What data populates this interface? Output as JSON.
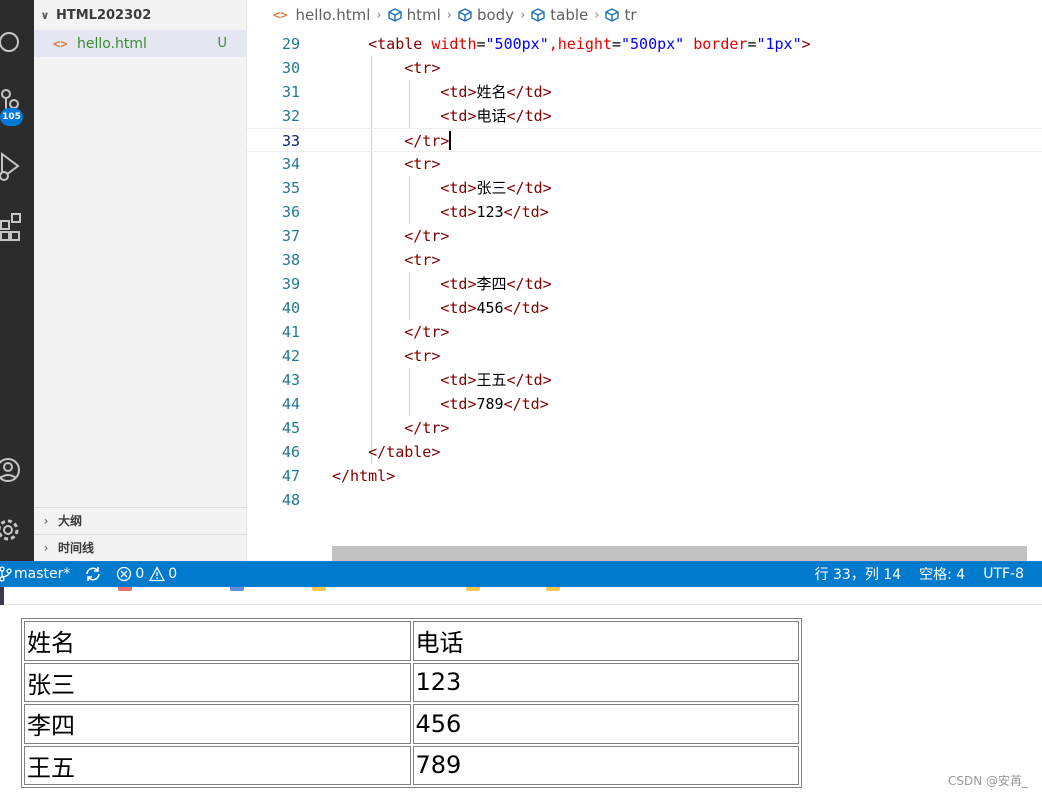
{
  "sidebar": {
    "folder_name": "HTML202302",
    "file_name": "hello.html",
    "file_status": "U",
    "outline_label": "大纲",
    "timeline_label": "时间线",
    "scm_badge": "105"
  },
  "breadcrumb": [
    "hello.html",
    "html",
    "body",
    "table",
    "tr"
  ],
  "editor": {
    "lines": [
      {
        "num": "29",
        "segments": [
          {
            "t": "    ",
            "c": "txt"
          },
          {
            "t": "<table",
            "c": "tag"
          },
          {
            "t": " width",
            "c": "attr"
          },
          {
            "t": "=",
            "c": "txt"
          },
          {
            "t": "\"500px\"",
            "c": "val"
          },
          {
            "t": ",height",
            "c": "attr"
          },
          {
            "t": "=",
            "c": "txt"
          },
          {
            "t": "\"500px\"",
            "c": "val"
          },
          {
            "t": " border",
            "c": "attr"
          },
          {
            "t": "=",
            "c": "txt"
          },
          {
            "t": "\"1px\"",
            "c": "val"
          },
          {
            "t": ">",
            "c": "tag"
          }
        ]
      },
      {
        "num": "30",
        "segments": [
          {
            "t": "        ",
            "c": "txt"
          },
          {
            "t": "<tr>",
            "c": "tag"
          }
        ]
      },
      {
        "num": "31",
        "segments": [
          {
            "t": "            ",
            "c": "txt"
          },
          {
            "t": "<td>",
            "c": "tag"
          },
          {
            "t": "姓名",
            "c": "txt"
          },
          {
            "t": "</td>",
            "c": "tag"
          }
        ]
      },
      {
        "num": "32",
        "segments": [
          {
            "t": "            ",
            "c": "txt"
          },
          {
            "t": "<td>",
            "c": "tag"
          },
          {
            "t": "电话",
            "c": "txt"
          },
          {
            "t": "</td>",
            "c": "tag"
          }
        ]
      },
      {
        "num": "33",
        "segments": [
          {
            "t": "        ",
            "c": "txt"
          },
          {
            "t": "</tr>",
            "c": "tag"
          }
        ],
        "current": true
      },
      {
        "num": "34",
        "segments": [
          {
            "t": "        ",
            "c": "txt"
          },
          {
            "t": "<tr>",
            "c": "tag"
          }
        ]
      },
      {
        "num": "35",
        "segments": [
          {
            "t": "            ",
            "c": "txt"
          },
          {
            "t": "<td>",
            "c": "tag"
          },
          {
            "t": "张三",
            "c": "txt"
          },
          {
            "t": "</td>",
            "c": "tag"
          }
        ]
      },
      {
        "num": "36",
        "segments": [
          {
            "t": "            ",
            "c": "txt"
          },
          {
            "t": "<td>",
            "c": "tag"
          },
          {
            "t": "123",
            "c": "txt"
          },
          {
            "t": "</td>",
            "c": "tag"
          }
        ]
      },
      {
        "num": "37",
        "segments": [
          {
            "t": "        ",
            "c": "txt"
          },
          {
            "t": "</tr>",
            "c": "tag"
          }
        ]
      },
      {
        "num": "38",
        "segments": [
          {
            "t": "        ",
            "c": "txt"
          },
          {
            "t": "<tr>",
            "c": "tag"
          }
        ]
      },
      {
        "num": "39",
        "segments": [
          {
            "t": "            ",
            "c": "txt"
          },
          {
            "t": "<td>",
            "c": "tag"
          },
          {
            "t": "李四",
            "c": "txt"
          },
          {
            "t": "</td>",
            "c": "tag"
          }
        ]
      },
      {
        "num": "40",
        "segments": [
          {
            "t": "            ",
            "c": "txt"
          },
          {
            "t": "<td>",
            "c": "tag"
          },
          {
            "t": "456",
            "c": "txt"
          },
          {
            "t": "</td>",
            "c": "tag"
          }
        ]
      },
      {
        "num": "41",
        "segments": [
          {
            "t": "        ",
            "c": "txt"
          },
          {
            "t": "</tr>",
            "c": "tag"
          }
        ]
      },
      {
        "num": "42",
        "segments": [
          {
            "t": "        ",
            "c": "txt"
          },
          {
            "t": "<tr>",
            "c": "tag"
          }
        ]
      },
      {
        "num": "43",
        "segments": [
          {
            "t": "            ",
            "c": "txt"
          },
          {
            "t": "<td>",
            "c": "tag"
          },
          {
            "t": "王五",
            "c": "txt"
          },
          {
            "t": "</td>",
            "c": "tag"
          }
        ]
      },
      {
        "num": "44",
        "segments": [
          {
            "t": "            ",
            "c": "txt"
          },
          {
            "t": "<td>",
            "c": "tag"
          },
          {
            "t": "789",
            "c": "txt"
          },
          {
            "t": "</td>",
            "c": "tag"
          }
        ]
      },
      {
        "num": "45",
        "segments": [
          {
            "t": "        ",
            "c": "txt"
          },
          {
            "t": "</tr>",
            "c": "tag"
          }
        ]
      },
      {
        "num": "46",
        "segments": [
          {
            "t": "    ",
            "c": "txt"
          },
          {
            "t": "</table>",
            "c": "tag"
          }
        ]
      },
      {
        "num": "47",
        "segments": [
          {
            "t": "</html>",
            "c": "tag"
          }
        ]
      },
      {
        "num": "48",
        "segments": []
      }
    ]
  },
  "statusbar": {
    "branch": "master*",
    "errors": "0",
    "warnings": "0",
    "position": "行 33，列 14",
    "spaces": "空格: 4",
    "encoding": "UTF-8"
  },
  "preview": {
    "rows": [
      [
        "姓名",
        "电话"
      ],
      [
        "张三",
        "123"
      ],
      [
        "李四",
        "456"
      ],
      [
        "王五",
        "789"
      ]
    ]
  },
  "watermark": "CSDN @安苒_",
  "colors": {
    "statusbar": "#007acc",
    "activity_bar": "#2c2c2c",
    "sidebar": "#f3f3f3",
    "tag": "#800000",
    "attr": "#e50000",
    "value": "#0000ff",
    "line_number": "#237893"
  }
}
